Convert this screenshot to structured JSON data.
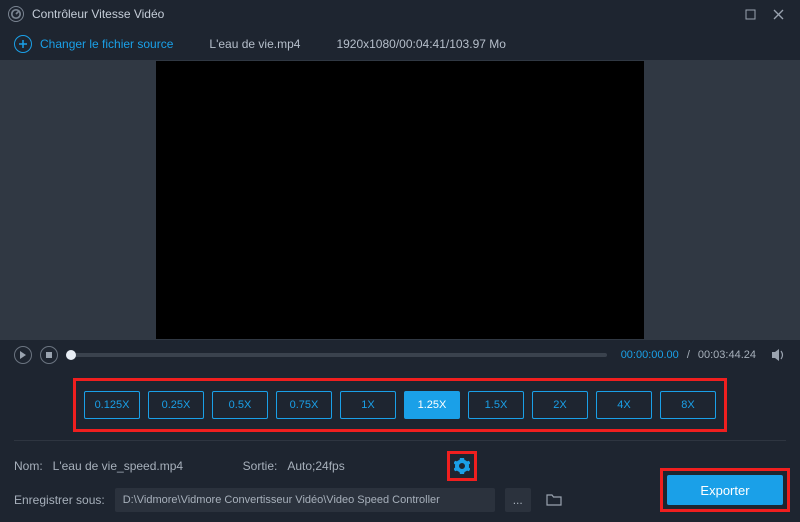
{
  "titlebar": {
    "app_glyph": "⦿",
    "title": "Contrôleur Vitesse Vidéo"
  },
  "source": {
    "change_label": "Changer le fichier source",
    "filename": "L'eau de vie.mp4",
    "metadata": "1920x1080/00:04:41/103.97 Mo"
  },
  "player": {
    "current_time": "00:00:00.00",
    "total_time": "00:03:44.24",
    "time_sep": "/"
  },
  "speeds": {
    "options": [
      "0.125X",
      "0.25X",
      "0.5X",
      "0.75X",
      "1X",
      "1.25X",
      "1.5X",
      "2X",
      "4X",
      "8X"
    ],
    "active_index": 5
  },
  "output": {
    "name_label": "Nom:",
    "name_value": "L'eau de vie_speed.mp4",
    "format_label": "Sortie:",
    "format_value": "Auto;24fps",
    "save_label": "Enregistrer sous:",
    "save_path": "D:\\Vidmore\\Vidmore Convertisseur Vidéo\\Video Speed Controller",
    "more_glyph": "..."
  },
  "actions": {
    "export_label": "Exporter"
  }
}
